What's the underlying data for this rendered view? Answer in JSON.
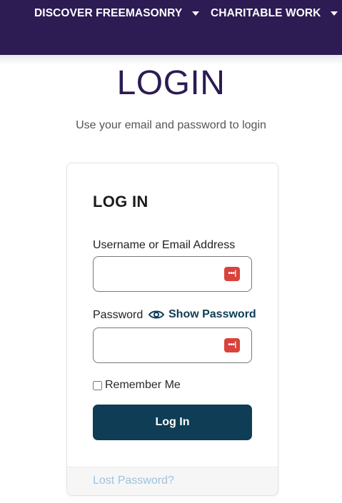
{
  "nav": {
    "items": [
      {
        "label": "DISCOVER FREEMASONRY",
        "icon": "caret-down-icon"
      },
      {
        "label": "CHARITABLE WORK",
        "icon": "caret-down-icon"
      }
    ]
  },
  "page": {
    "title": "LOGIN",
    "subtitle": "Use your email and password to login"
  },
  "login_card": {
    "heading": "LOG IN",
    "username_label": "Username or Email Address",
    "username_value": "",
    "password_label": "Password",
    "password_value": "",
    "show_password_label": "Show Password",
    "password_manager_icon": "password-manager-icon",
    "remember_label": "Remember Me",
    "remember_checked": false,
    "submit_label": "Log In",
    "lost_password_label": "Lost Password?"
  },
  "colors": {
    "nav_bg": "#2d1b53",
    "title": "#2d1b53",
    "button_bg": "#0e3d55",
    "accent": "#0e3d55",
    "link_muted": "#9ec3dd",
    "pm_icon": "#d9433b"
  }
}
